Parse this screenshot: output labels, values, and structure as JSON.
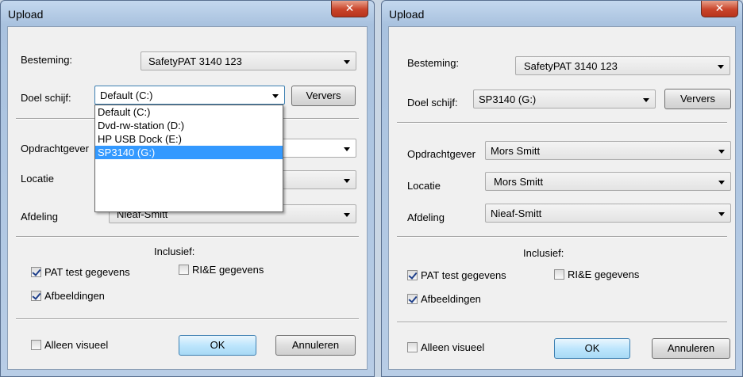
{
  "left_dialog": {
    "title": "Upload",
    "labels": {
      "bestemming": "Besteming:",
      "doel": "Doel schijf:",
      "opdracht": "Opdrachtgever",
      "locatie": "Locatie",
      "afdeling": "Afdeling",
      "inclusief": "Inclusief:"
    },
    "bestemming_value": "SafetyPAT 3140 123",
    "doel_value": "Default (C:)",
    "afdeling_value": "Nieaf-Smitt",
    "refresh_label": "Ververs",
    "dropdown_options": [
      "Default (C:)",
      "Dvd-rw-station (D:)",
      "HP USB Dock (E:)",
      "SP3140 (G:)"
    ],
    "dropdown_selected_index": 3,
    "checks": {
      "pat": {
        "label": "PAT test gegevens",
        "checked": true
      },
      "rie": {
        "label": "RI&E gegevens",
        "checked": false
      },
      "afb": {
        "label": "Afbeeldingen",
        "checked": true
      },
      "vis": {
        "label": "Alleen visueel",
        "checked": false
      }
    },
    "ok_label": "OK",
    "cancel_label": "Annuleren"
  },
  "right_dialog": {
    "title": "Upload",
    "labels": {
      "bestemming": "Besteming:",
      "doel": "Doel schijf:",
      "opdracht": "Opdrachtgever",
      "locatie": "Locatie",
      "afdeling": "Afdeling",
      "inclusief": "Inclusief:"
    },
    "bestemming_value": "SafetyPAT 3140 123",
    "doel_value": "SP3140 (G:)",
    "opdracht_value": "Mors Smitt",
    "locatie_value": "Mors Smitt",
    "afdeling_value": "Nieaf-Smitt",
    "refresh_label": "Ververs",
    "checks": {
      "pat": {
        "label": "PAT test gegevens",
        "checked": true
      },
      "rie": {
        "label": "RI&E gegevens",
        "checked": false
      },
      "afb": {
        "label": "Afbeeldingen",
        "checked": true
      },
      "vis": {
        "label": "Alleen visueel",
        "checked": false
      }
    },
    "ok_label": "OK",
    "cancel_label": "Annuleren"
  },
  "colors": {
    "selection": "#3399ff",
    "close_button": "#c9442a"
  },
  "icons": {
    "close": "close-icon",
    "dropdown": "chevron-down-icon",
    "checkbox": "checkmark-icon"
  }
}
